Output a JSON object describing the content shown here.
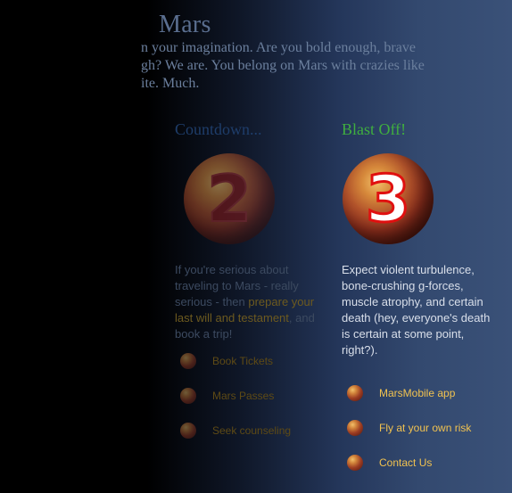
{
  "intro": {
    "title": "Mars",
    "line1": "n your imagination. Are you bold enough, brave",
    "line2": "gh? We are. You belong on Mars with crazies like",
    "line3": "ite. Much."
  },
  "columns": {
    "countdown": {
      "heading": "Countdown...",
      "number": "2",
      "text_before": "If you're serious about traveling to Mars - really serious - then ",
      "link_text": "prepare your last will and testament",
      "text_after": ", and book a trip!",
      "links": [
        "Book Tickets",
        "Mars Passes",
        "Seek counseling"
      ]
    },
    "blastoff": {
      "heading": "Blast Off!",
      "number": "3",
      "text": "Expect violent turbulence, bone-crushing g-forces, muscle atrophy, and certain death (hey, everyone's death is certain at some point, right?).",
      "links": [
        "MarsMobile app",
        "Fly at your own risk",
        "Contact Us"
      ]
    }
  }
}
